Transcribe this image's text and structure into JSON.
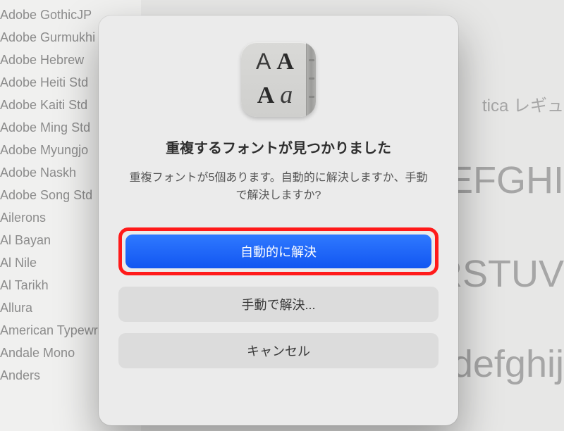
{
  "sidebar": {
    "items": [
      {
        "label": "Adobe GothicJP"
      },
      {
        "label": "Adobe Gurmukhi"
      },
      {
        "label": "Adobe Hebrew"
      },
      {
        "label": "Adobe Heiti Std"
      },
      {
        "label": "Adobe Kaiti Std"
      },
      {
        "label": "Adobe Ming Std"
      },
      {
        "label": "Adobe Myungjo"
      },
      {
        "label": "Adobe Naskh"
      },
      {
        "label": "Adobe Song Std"
      },
      {
        "label": "Ailerons"
      },
      {
        "label": "Al Bayan"
      },
      {
        "label": "Al Nile"
      },
      {
        "label": "Al Tarikh"
      },
      {
        "label": "Allura"
      },
      {
        "label": "American Typewriter"
      },
      {
        "label": "Andale Mono"
      },
      {
        "label": "Anders"
      }
    ]
  },
  "preview": {
    "style_label": "tica レギュ",
    "sample1": "EFGHI",
    "sample2": "RSTUV",
    "sample3": "defghij"
  },
  "dialog": {
    "title": "重複するフォントが見つかりました",
    "message": "重複フォントが5個あります。自動的に解決しますか、手動で解決しますか?",
    "primary_label": "自動的に解決",
    "manual_label": "手動で解決...",
    "cancel_label": "キャンセル"
  }
}
